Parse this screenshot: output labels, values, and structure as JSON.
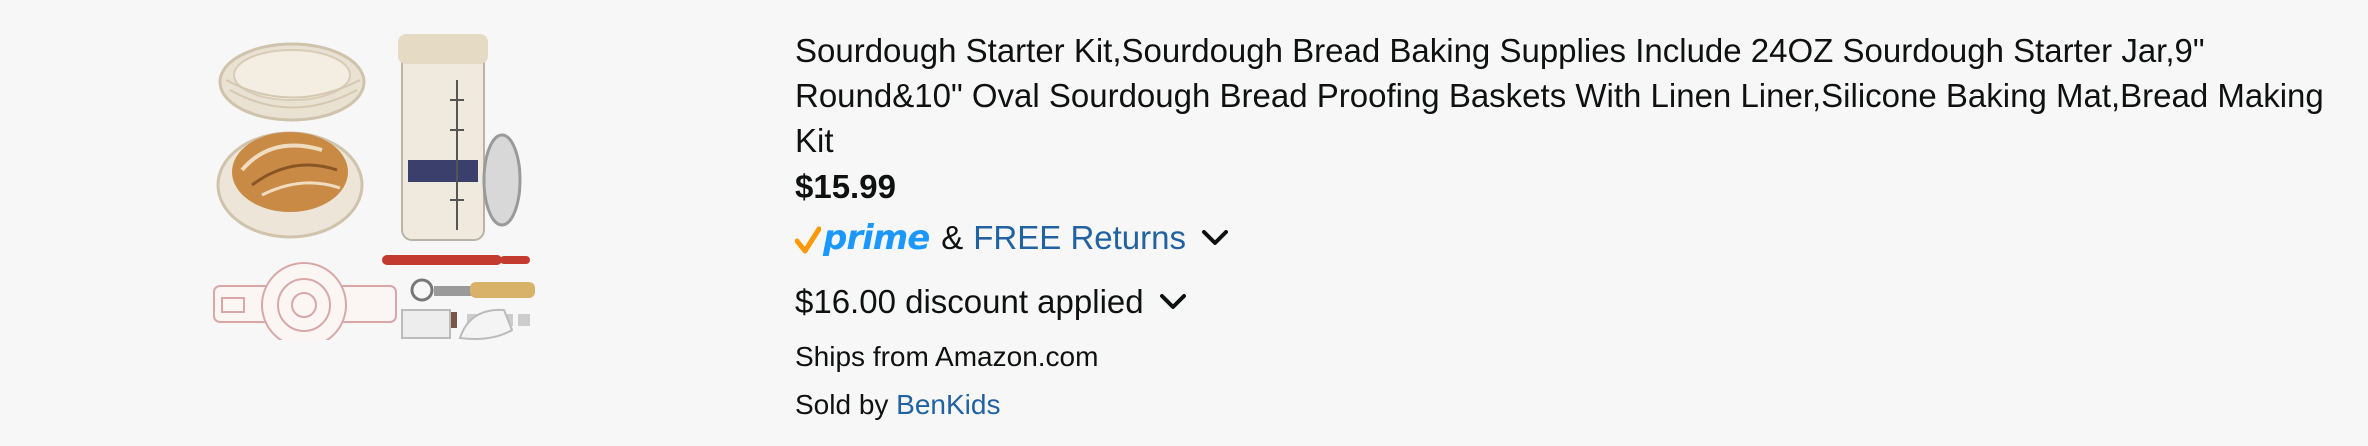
{
  "product": {
    "title": "Sourdough Starter Kit,Sourdough Bread Baking Supplies Include 24OZ Sourdough Starter Jar,9\" Round&10\" Oval Sourdough Bread Proofing Baskets With Linen Liner,Silicone Baking Mat,Bread Making Kit",
    "price": "$15.99",
    "prime_label": "prime",
    "ampersand": "&",
    "free_returns_label": "FREE Returns",
    "discount_text": "$16.00 discount applied",
    "ships_from": "Ships from Amazon.com",
    "sold_by_prefix": "Sold by ",
    "seller": "BenKids",
    "image_icon": "product-image"
  },
  "colors": {
    "prime_blue": "#1a98ff",
    "prime_check": "#ff9900",
    "link_blue": "#2162a1",
    "text": "#0f1111",
    "background": "#f7f7f7"
  }
}
